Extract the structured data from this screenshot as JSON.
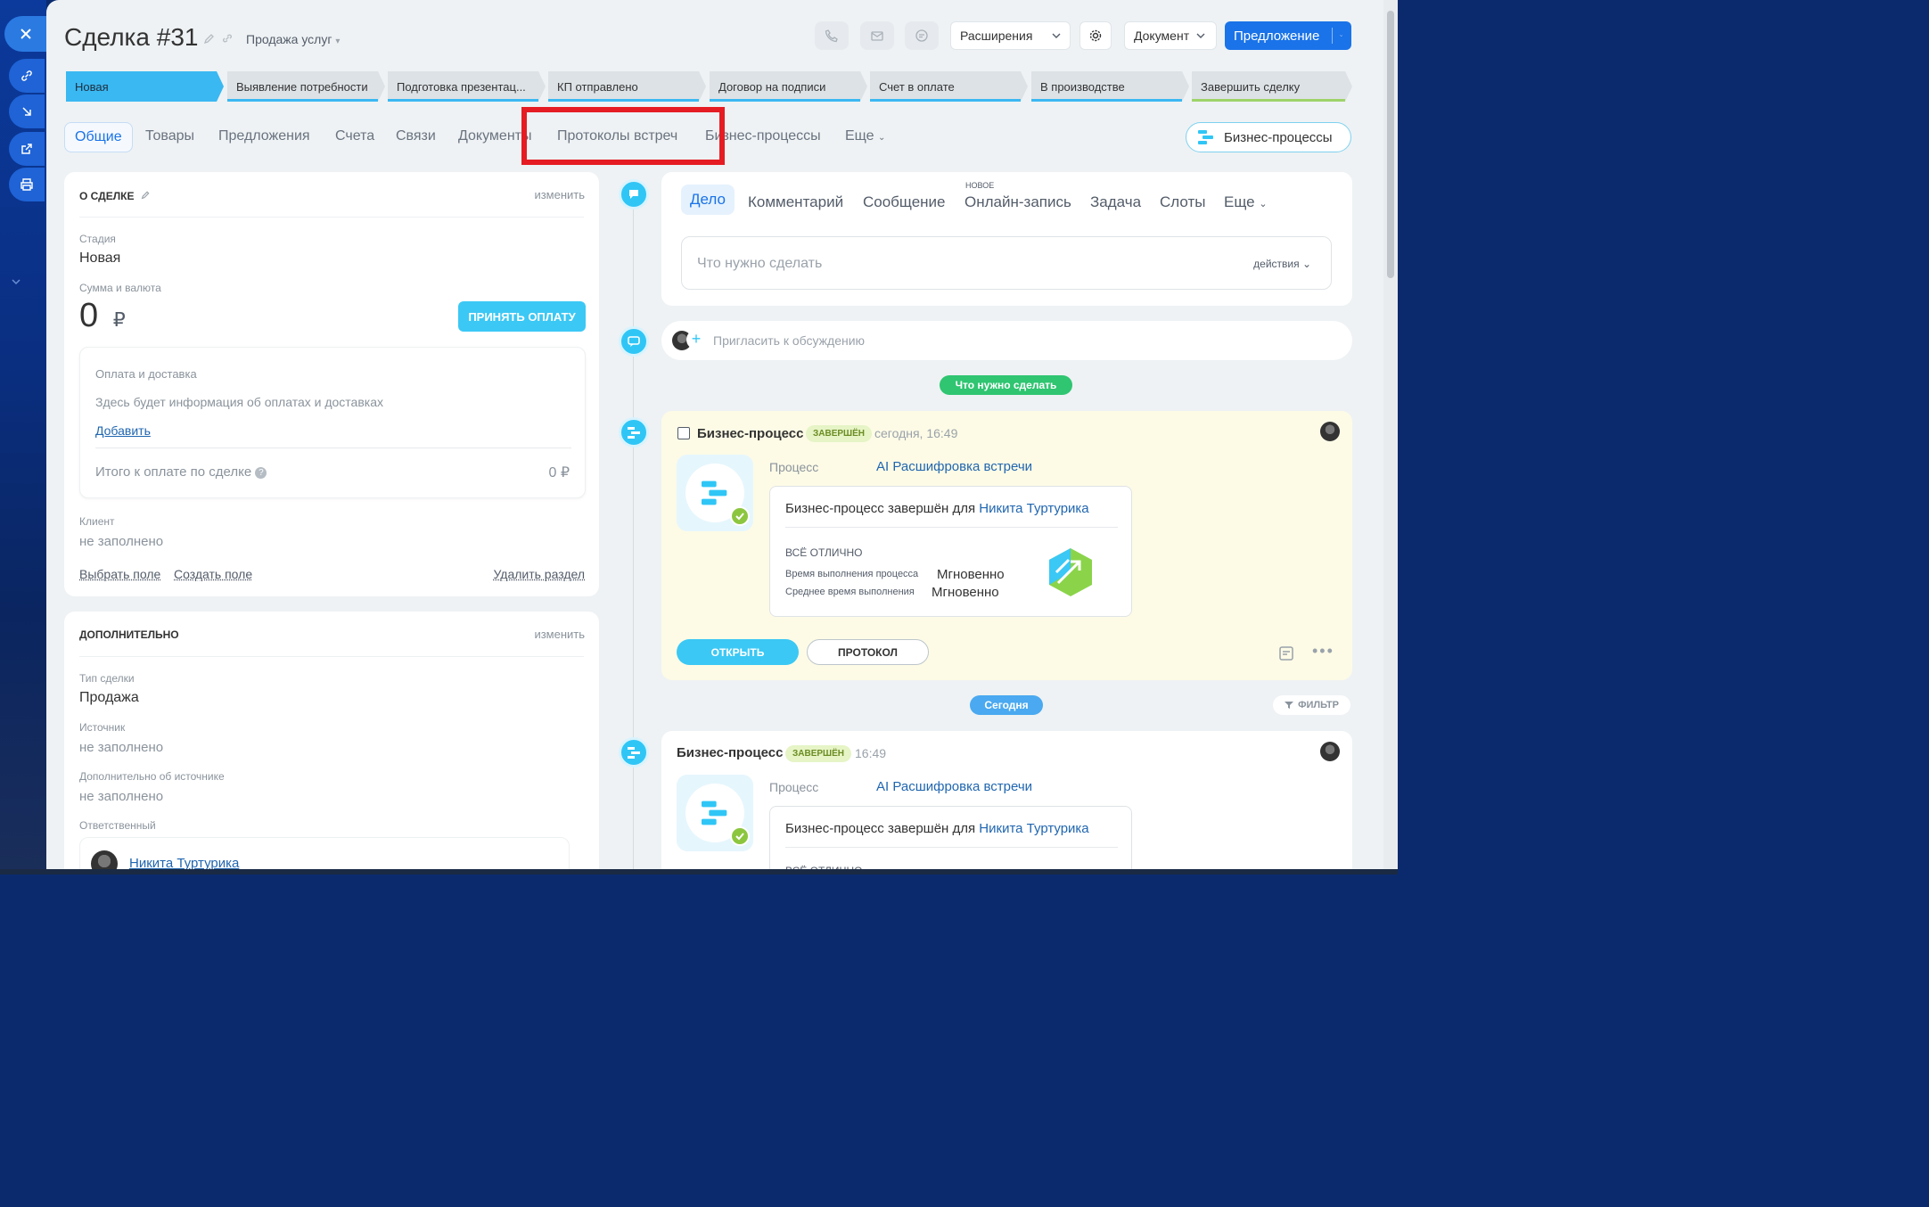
{
  "header": {
    "title": "Сделка #31",
    "category": "Продажа услуг",
    "extensions_label": "Расширения",
    "document_label": "Документ",
    "proposal_label": "Предложение"
  },
  "stages": [
    {
      "label": "Новая"
    },
    {
      "label": "Выявление потребности"
    },
    {
      "label": "Подготовка презентац..."
    },
    {
      "label": "КП отправлено"
    },
    {
      "label": "Договор на подписи"
    },
    {
      "label": "Счет в оплате"
    },
    {
      "label": "В производстве"
    },
    {
      "label": "Завершить сделку"
    }
  ],
  "tabs": [
    {
      "label": "Общие"
    },
    {
      "label": "Товары"
    },
    {
      "label": "Предложения"
    },
    {
      "label": "Счета"
    },
    {
      "label": "Связи"
    },
    {
      "label": "Документы"
    },
    {
      "label": "Протоколы встреч"
    },
    {
      "label": "Бизнес-процессы"
    },
    {
      "label": "Еще"
    }
  ],
  "bp_button": "Бизнес-процессы",
  "about": {
    "title": "О СДЕЛКЕ",
    "edit": "изменить",
    "stage_label": "Стадия",
    "stage_value": "Новая",
    "sum_label": "Сумма и валюта",
    "sum_value": "0",
    "currency": "₽",
    "accept_payment": "ПРИНЯТЬ ОПЛАТУ",
    "payment_title": "Оплата и доставка",
    "payment_info": "Здесь будет информация об оплатах и доставках",
    "add": "Добавить",
    "total_label": "Итого к оплате по сделке",
    "total_value": "0 ₽",
    "client_label": "Клиент",
    "client_value": "не заполнено",
    "choose_field": "Выбрать поле",
    "create_field": "Создать поле",
    "delete_section": "Удалить раздел"
  },
  "additional": {
    "title": "ДОПОЛНИТЕЛЬНО",
    "edit": "изменить",
    "type_label": "Тип сделки",
    "type_value": "Продажа",
    "source_label": "Источник",
    "source_value": "не заполнено",
    "source_more_label": "Дополнительно об источнике",
    "source_more_value": "не заполнено",
    "responsible_label": "Ответственный",
    "responsible_name": "Никита Туртурика"
  },
  "activity": {
    "tabs": [
      {
        "label": "Дело"
      },
      {
        "label": "Комментарий"
      },
      {
        "label": "Сообщение"
      },
      {
        "label": "Онлайн-запись"
      },
      {
        "label": "Задача"
      },
      {
        "label": "Слоты"
      },
      {
        "label": "Еще"
      }
    ],
    "new_badge": "НОВОЕ",
    "placeholder": "Что нужно сделать",
    "actions": "действия",
    "invite": "Пригласить к обсуждению"
  },
  "timeline": {
    "todo_pill": "Что нужно сделать",
    "today_pill": "Сегодня",
    "filter": "ФИЛЬТР",
    "items": [
      {
        "title": "Бизнес-процесс",
        "badge": "ЗАВЕРШЁН",
        "time": "сегодня, 16:49",
        "process_label": "Процесс",
        "process_name": "AI Расшифровка встречи",
        "done_text": "Бизнес-процесс завершён для",
        "user": "Никита Туртурика",
        "result": "ВСЁ ОТЛИЧНО",
        "exec_label": "Время выполнения процесса",
        "exec_value": "Мгновенно",
        "avg_label": "Среднее время выполнения",
        "avg_value": "Мгновенно",
        "open_btn": "ОТКРЫТЬ",
        "protocol_btn": "ПРОТОКОЛ"
      },
      {
        "title": "Бизнес-процесс",
        "badge": "ЗАВЕРШЁН",
        "time": "16:49",
        "process_label": "Процесс",
        "process_name": "AI Расшифровка встречи",
        "done_text": "Бизнес-процесс завершён для",
        "user": "Никита Туртурика",
        "result": "ВСЁ ОТЛИЧНО"
      }
    ]
  },
  "colors": {
    "accent": "#1a73e8",
    "stage_active": "#3ab8f2",
    "highlight": "#e51c23",
    "timeline_icon": "#2fc6f6",
    "bp_card_bg": "#fdfbe6"
  }
}
